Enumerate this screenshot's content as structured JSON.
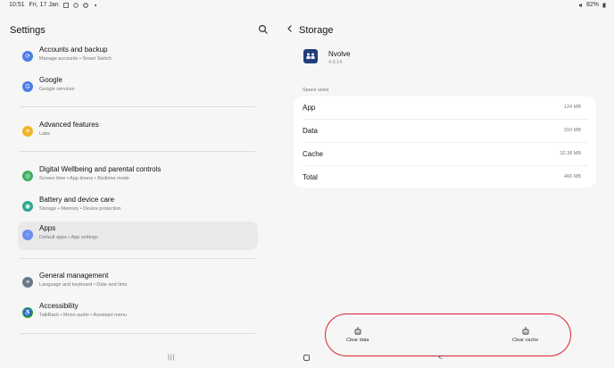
{
  "status_bar": {
    "time": "10:51",
    "date": "Fri, 17 Jan",
    "battery": "82%"
  },
  "left": {
    "title": "Settings",
    "items": [
      {
        "title": "Accounts and backup",
        "sub": "Manage accounts  •  Smart Switch",
        "icon": "sync-icon",
        "color": "#4a7de8"
      },
      {
        "title": "Google",
        "sub": "Google services",
        "icon": "google-icon",
        "color": "#4a7de8"
      },
      {
        "title": "Advanced features",
        "sub": "Labs",
        "icon": "star-gear-icon",
        "color": "#f1b52a"
      },
      {
        "title": "Digital Wellbeing and parental controls",
        "sub": "Screen time  •  App timers  •  Bedtime mode",
        "icon": "wellbeing-icon",
        "color": "#3fae5b"
      },
      {
        "title": "Battery and device care",
        "sub": "Storage  •  Memory  •  Device protection",
        "icon": "battery-care-icon",
        "color": "#2ca88f"
      },
      {
        "title": "Apps",
        "sub": "Default apps  •  App settings",
        "icon": "apps-icon",
        "color": "#6a8ff0"
      },
      {
        "title": "General management",
        "sub": "Language and keyboard  •  Date and time",
        "icon": "sliders-icon",
        "color": "#6b7a8a"
      },
      {
        "title": "Accessibility",
        "sub": "TalkBack  •  Mono audio  •  Assistant menu",
        "icon": "accessibility-icon",
        "color": "#2e9c3f"
      }
    ]
  },
  "right": {
    "title": "Storage",
    "app_name": "Nvolve",
    "app_version": "4.0.14",
    "section_label": "Space used",
    "rows": [
      {
        "label": "App",
        "value": "124 MB"
      },
      {
        "label": "Data",
        "value": "310 MB"
      },
      {
        "label": "Cache",
        "value": "32.38 MB"
      },
      {
        "label": "Total",
        "value": "466 MB"
      }
    ],
    "clear_data": "Clear data",
    "clear_cache": "Clear cache"
  },
  "nav": {
    "recents_glyph": "|||",
    "back_glyph": "<"
  }
}
